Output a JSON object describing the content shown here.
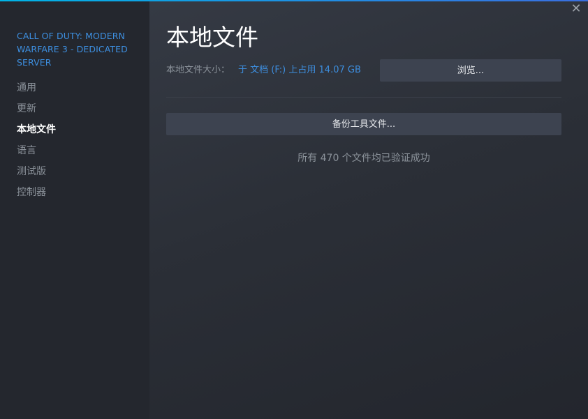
{
  "window": {
    "close_icon": "close-icon",
    "close_glyph": "✕"
  },
  "sidebar": {
    "game_title": "CALL OF DUTY: MODERN WARFARE 3 - DEDICATED SERVER",
    "items": [
      {
        "label": "通用",
        "active": false
      },
      {
        "label": "更新",
        "active": false
      },
      {
        "label": "本地文件",
        "active": true
      },
      {
        "label": "语言",
        "active": false
      },
      {
        "label": "测试版",
        "active": false
      },
      {
        "label": "控制器",
        "active": false
      }
    ]
  },
  "main": {
    "title": "本地文件",
    "size_label": "本地文件大小：",
    "size_value": "于 文档 (F:) 上占用 14.07 GB",
    "browse_label": "浏览...",
    "backup_label": "备份工具文件...",
    "verify_status": "所有 470 个文件均已验证成功"
  },
  "colors": {
    "accent": "#3d8fe0",
    "background": "#23262e",
    "button": "#3d4350"
  }
}
